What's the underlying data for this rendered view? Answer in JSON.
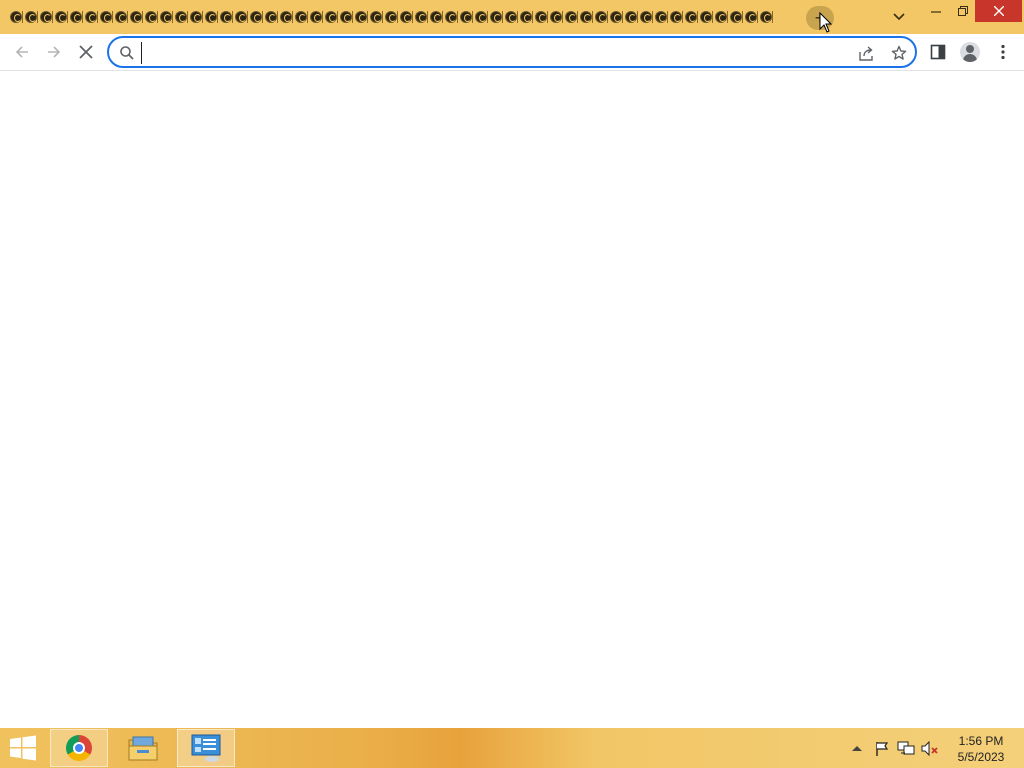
{
  "window": {
    "minimize_icon": "minimize-icon",
    "maximize_icon": "restore-icon",
    "close_icon": "close-icon"
  },
  "tabs": {
    "count": 51,
    "favicon_icon": "tab-favicon-icon",
    "new_tab_label": "+",
    "tab_search_icon": "chevron-down-icon"
  },
  "toolbar": {
    "back_icon": "arrow-left-icon",
    "forward_icon": "arrow-right-icon",
    "stop_icon": "stop-x-icon",
    "omnibox": {
      "value": "",
      "search_icon": "search-icon",
      "share_icon": "share-icon",
      "bookmark_icon": "star-icon"
    },
    "side_panel_icon": "side-panel-icon",
    "profile_icon": "profile-icon",
    "menu_icon": "kebab-menu-icon"
  },
  "taskbar": {
    "start_icon": "windows-logo-icon",
    "apps": [
      {
        "name": "Google Chrome",
        "icon": "chrome-icon",
        "active": true
      },
      {
        "name": "File Explorer",
        "icon": "folder-icon",
        "active": false
      },
      {
        "name": "Control Panel",
        "icon": "control-panel-icon",
        "active": true
      }
    ],
    "tray": {
      "show_hidden_icon": "chevron-up-icon",
      "action_center_icon": "flag-icon",
      "network_icon": "network-icon",
      "volume_icon": "volume-muted-icon"
    },
    "clock": {
      "time": "1:56 PM",
      "date": "5/5/2023"
    }
  },
  "colors": {
    "titlebar": "#f3c766",
    "accent": "#1a73e8",
    "close_button": "#c7352b"
  }
}
